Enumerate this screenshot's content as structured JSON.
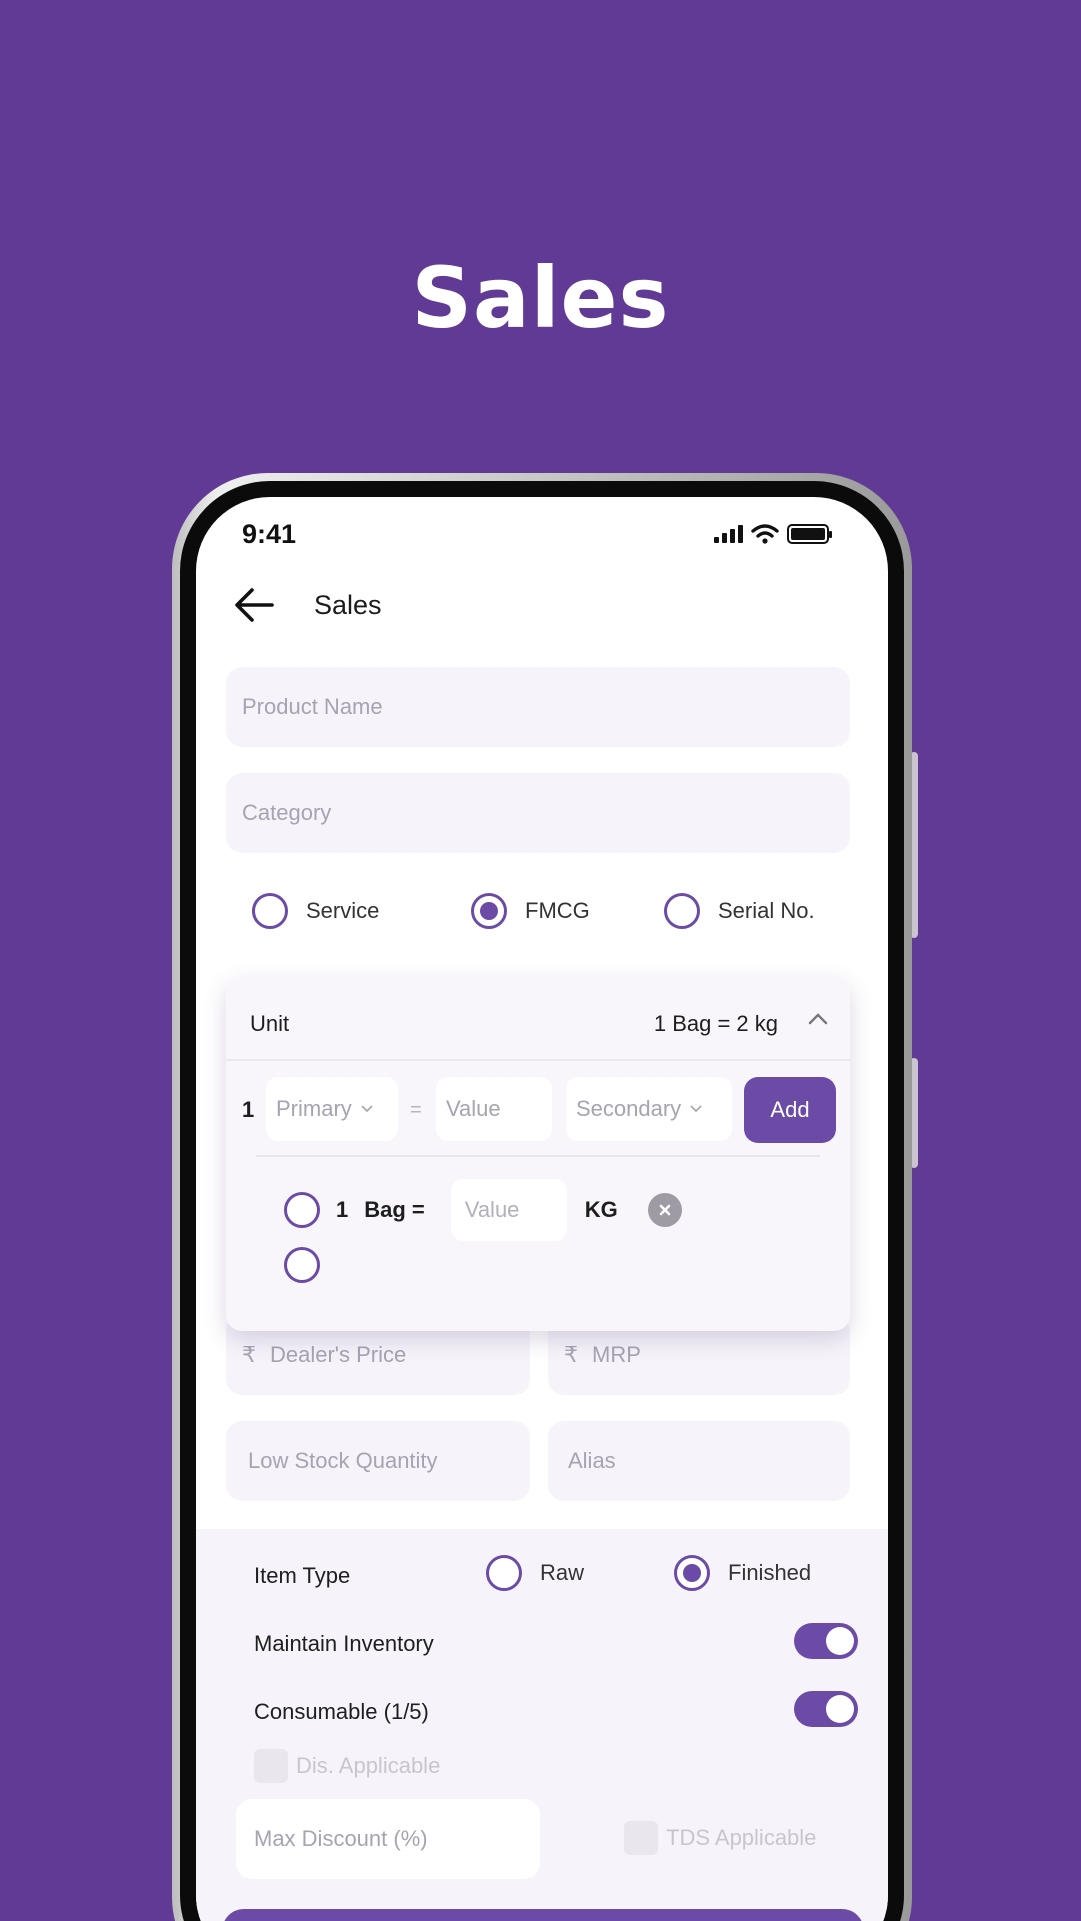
{
  "page": {
    "heading": "Sales"
  },
  "status_bar": {
    "time": "9:41",
    "icons": [
      "signal-icon",
      "wifi-icon",
      "battery-icon"
    ]
  },
  "app_bar": {
    "title": "Sales",
    "back_icon": "arrow-left-icon"
  },
  "form": {
    "product_name_placeholder": "Product Name",
    "category_placeholder": "Category",
    "product_kind": {
      "options": [
        "Service",
        "FMCG",
        "Serial No."
      ],
      "selected": "FMCG"
    },
    "unit": {
      "label": "Unit",
      "summary": "1 Bag = 2 kg",
      "expanded": true,
      "conversion": {
        "quantity": "1",
        "primary_placeholder": "Primary",
        "equals": "=",
        "value_placeholder": "Value",
        "secondary_placeholder": "Secondary",
        "add_label": "Add"
      },
      "rows": [
        {
          "qty": "1",
          "unit_text": "Bag =",
          "value_placeholder": "Value",
          "target_unit": "KG"
        }
      ]
    },
    "dealer_price_placeholder": "Dealer's Price",
    "mrp_placeholder": "MRP",
    "currency_symbol": "₹",
    "low_stock_placeholder": "Low Stock Quantity",
    "alias_placeholder": "Alias"
  },
  "settings": {
    "item_type": {
      "label": "Item Type",
      "options": [
        "Raw",
        "Finished"
      ],
      "selected": "Finished"
    },
    "maintain_inventory": {
      "label": "Maintain Inventory",
      "on": true
    },
    "consumable": {
      "label": "Consumable (1/5)",
      "on": true
    },
    "dis_applicable": {
      "label": "Dis. Applicable",
      "checked": false
    },
    "max_discount_placeholder": "Max Discount (%)",
    "tds_applicable": {
      "label": "TDS Applicable",
      "checked": false
    }
  },
  "colors": {
    "background": "#613a96",
    "accent": "#6b4ba6",
    "field_bg": "#f6f4fa"
  }
}
